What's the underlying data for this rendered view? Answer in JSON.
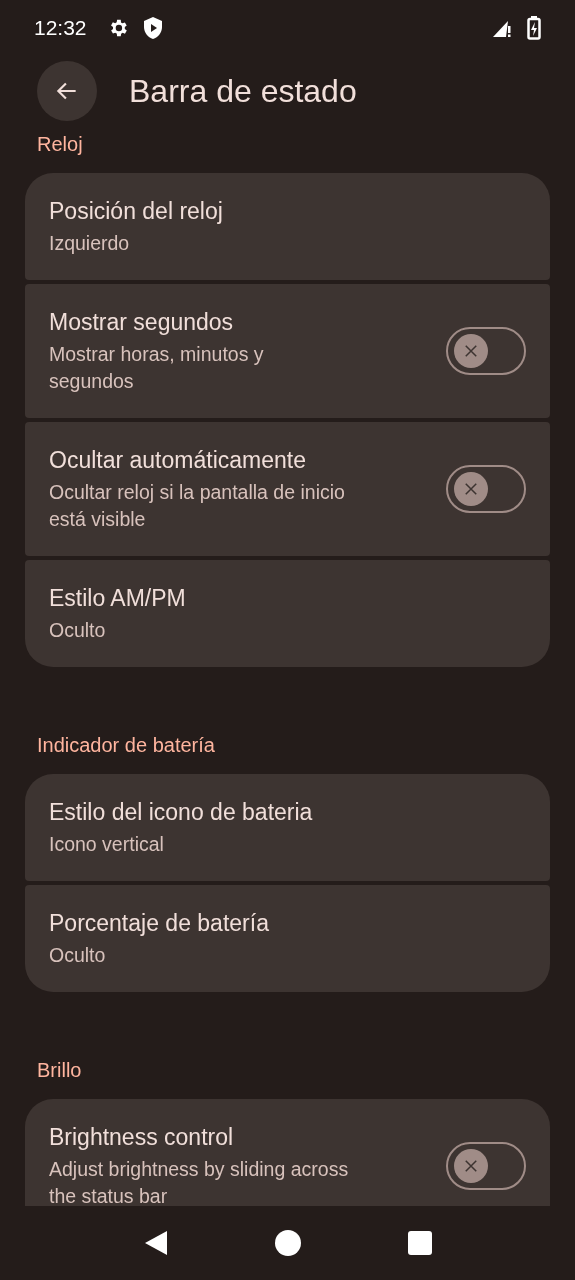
{
  "status_bar": {
    "time": "12:32"
  },
  "header": {
    "title": "Barra de estado"
  },
  "sections": [
    {
      "title": "Reloj",
      "items": [
        {
          "kind": "link",
          "title": "Posición del reloj",
          "summary": "Izquierdo"
        },
        {
          "kind": "switch",
          "title": "Mostrar segundos",
          "summary": "Mostrar horas, minutos y segundos",
          "on": false
        },
        {
          "kind": "switch",
          "title": "Ocultar automáticamente",
          "summary": "Ocultar reloj si la pantalla de inicio está visible",
          "on": false
        },
        {
          "kind": "link",
          "title": "Estilo AM/PM",
          "summary": "Oculto"
        }
      ]
    },
    {
      "title": "Indicador de batería",
      "items": [
        {
          "kind": "link",
          "title": "Estilo del icono de bateria",
          "summary": "Icono vertical"
        },
        {
          "kind": "link",
          "title": "Porcentaje de batería",
          "summary": "Oculto"
        }
      ]
    },
    {
      "title": "Brillo",
      "items": [
        {
          "kind": "switch",
          "title": "Brightness control",
          "summary": "Adjust brightness by sliding across the status bar",
          "on": false
        }
      ]
    }
  ]
}
